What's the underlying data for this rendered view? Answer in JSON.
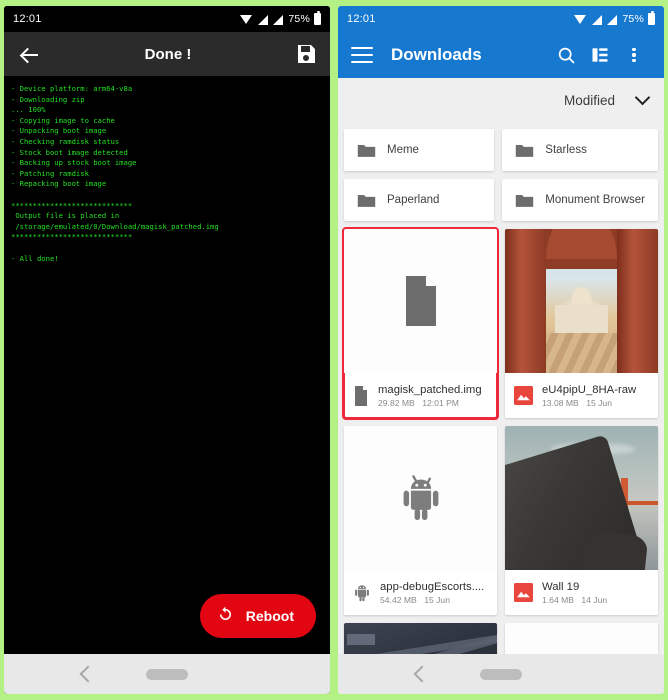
{
  "left_phone": {
    "statusbar": {
      "time": "12:01",
      "battery_pct": "75%",
      "icons": [
        "wifi-icon",
        "signal-icon",
        "signal-icon",
        "battery-icon"
      ]
    },
    "toolbar": {
      "back": "back-arrow-icon",
      "title": "Done !",
      "save": "save-icon"
    },
    "console_lines": [
      "- Device platform: arm64-v8a",
      "- Downloading zip",
      "... 100%",
      "- Copying image to cache",
      "- Unpacking boot image",
      "- Checking ramdisk status",
      "- Stock boot image detected",
      "- Backing up stock boot image",
      "- Patching ramdisk",
      "- Repacking boot image",
      "",
      "****************************",
      " Output file is placed in",
      " /storage/emulated/0/Download/magisk_patched.img",
      "****************************",
      "",
      "- All done!"
    ],
    "fab": {
      "label": "Reboot",
      "icon": "reboot-icon",
      "color": "#e20613"
    },
    "navbar": {
      "back": "nav-back-icon",
      "home": "home-pill-indicator"
    }
  },
  "right_phone": {
    "statusbar": {
      "time": "12:01",
      "battery_pct": "75%",
      "icons": [
        "wifi-icon",
        "signal-icon",
        "signal-icon",
        "battery-icon"
      ]
    },
    "toolbar": {
      "menu": "hamburger-menu-icon",
      "title": "Downloads",
      "search": "search-icon",
      "view": "list-view-icon",
      "overflow": "overflow-menu-icon",
      "color": "#1678cf"
    },
    "sortbar": {
      "label": "Modified",
      "chevron": "chevron-down-icon"
    },
    "folders": [
      {
        "name": "Meme"
      },
      {
        "name": "Starless"
      },
      {
        "name": "Paperland"
      },
      {
        "name": "Monument Browser"
      }
    ],
    "files": [
      {
        "name": "magisk_patched.img",
        "size": "29.82 MB",
        "date": "12:01 PM",
        "icon": "document-icon",
        "thumb": "document",
        "selected": true
      },
      {
        "name": "eU4pipU_8HA-raw",
        "size": "13.08 MB",
        "date": "15 Jun",
        "icon": "image-icon",
        "thumb": "photo-taj-mahal",
        "selected": false
      },
      {
        "name": "app-debugEscorts....",
        "size": "54.42 MB",
        "date": "15 Jun",
        "icon": "android-apk-icon",
        "thumb": "android",
        "selected": false
      },
      {
        "name": "Wall 19",
        "size": "1.64 MB",
        "date": "14 Jun",
        "icon": "image-icon",
        "thumb": "photo-golden-gate",
        "selected": false
      },
      {
        "name": "",
        "size": "",
        "date": "",
        "icon": "image-icon",
        "thumb": "photo-aerial-city",
        "selected": false
      },
      {
        "name": "",
        "size": "",
        "date": "",
        "icon": "",
        "thumb": "blank",
        "selected": false
      }
    ],
    "navbar": {
      "back": "nav-back-icon",
      "home": "home-pill-indicator"
    }
  }
}
